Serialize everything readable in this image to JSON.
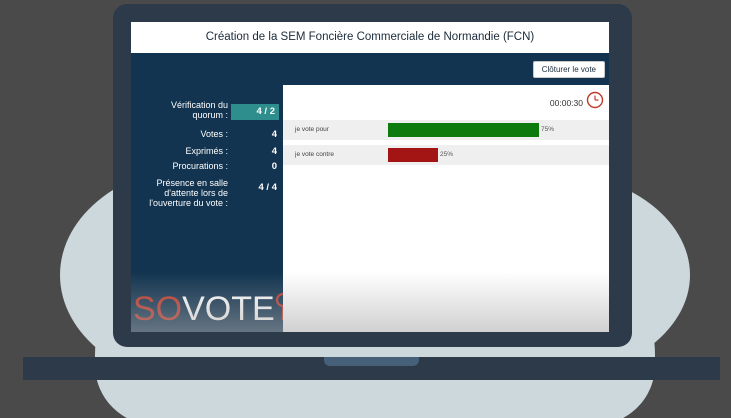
{
  "window": {
    "title": "Création de la SEM Foncière Commerciale de Normandie (FCN)"
  },
  "toolbar": {
    "close_vote_label": "Clôturer le vote"
  },
  "stats": {
    "quorum": {
      "label": "Vérification du quorum :",
      "value": "4 / 2"
    },
    "votes": {
      "label": "Votes :",
      "value": "4"
    },
    "expressed": {
      "label": "Exprimés :",
      "value": "4"
    },
    "proxies": {
      "label": "Procurations :",
      "value": "0"
    },
    "presence": {
      "label": "Présence en salle d'attente lors de l'ouverture du vote :",
      "value": "4 / 4"
    }
  },
  "timer": {
    "value": "00:00:30",
    "icon": "clock-icon"
  },
  "vote_options": [
    {
      "label": "je vote pour",
      "percent_label": "75%",
      "percent": 75,
      "color": "#0d7a0d"
    },
    {
      "label": "je vote contre",
      "percent_label": "25%",
      "percent": 25,
      "color": "#a31414"
    }
  ],
  "brand": {
    "logo_so": "SO",
    "logo_vote": "VOTE",
    "accent": "#c0392b"
  },
  "colors": {
    "panel_bg": "#123450",
    "quorum_highlight": "#2e8d8d",
    "frame": "#2c3a4a"
  }
}
